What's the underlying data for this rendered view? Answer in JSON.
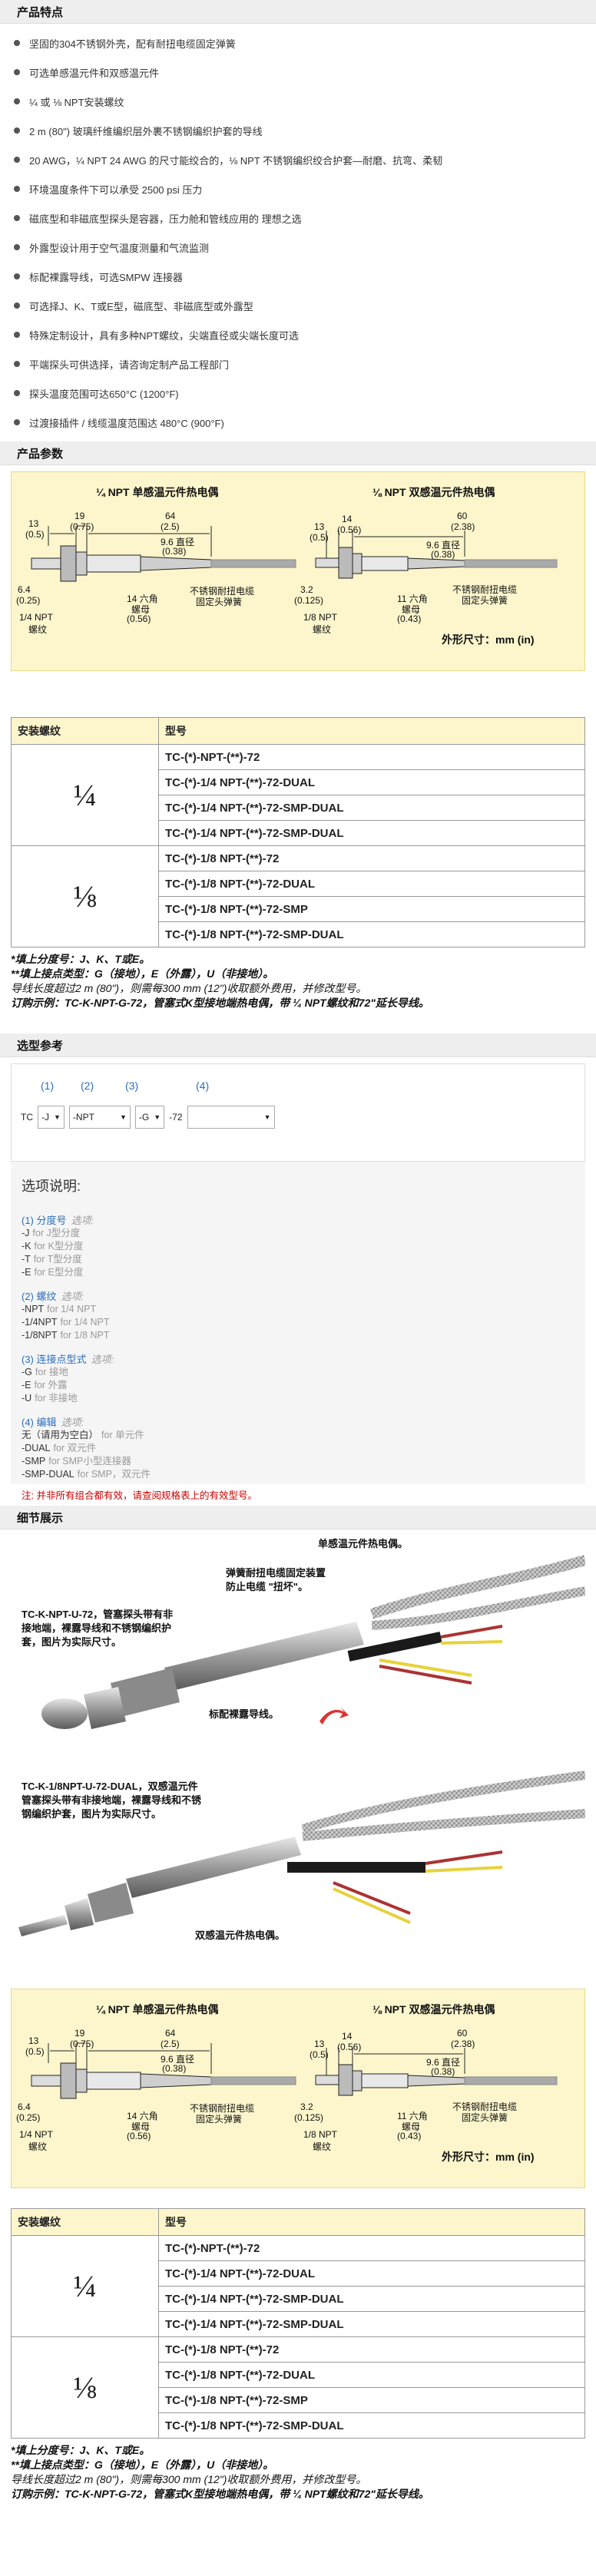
{
  "features": {
    "heading": "产品特点",
    "items": [
      "坚固的304不锈钢外壳，配有耐扭电缆固定弹簧",
      "可选单感温元件和双感温元件",
      "¼ 或 ⅛ NPT安装螺纹",
      "2 m (80\") 玻璃纤维编织层外裹不锈钢编织护套的导线",
      "20 AWG，¼ NPT 24 AWG 的尺寸能绞合的，⅛ NPT 不锈钢编织绞合护套—耐磨、抗弯、柔韧",
      "环境温度条件下可以承受 2500 psi 压力",
      "磁底型和非磁底型探头是容器，压力舱和管线应用的 理想之选",
      "外露型设计用于空气温度测量和气流监测",
      "标配裸露导线，可选SMPW 连接器",
      "可选择J、K、T或E型，磁底型、非磁底型或外露型",
      "特殊定制设计，具有多种NPT螺纹，尖端直径或尖端长度可选",
      "平端探头可供选择，请咨询定制产品工程部门",
      "探头温度范围可达650°C (1200°F)",
      "过渡接插件 / 线缆温度范围达 480°C (900°F)"
    ]
  },
  "params": {
    "heading": "产品参数"
  },
  "diagram": {
    "left_title": "¼ NPT 单感温元件热电偶",
    "right_title": "⅛ NPT 双感温元件热电偶",
    "left_dims": {
      "d13": "13",
      "d13b": "(0.5)",
      "d19": "19",
      "d19b": "(0.75)",
      "d64": "64",
      "d64b": "(2.5)",
      "dia": "9.6 直径",
      "diab": "(0.38)",
      "d64s": "6.4",
      "d64sb": "(0.25)",
      "hex": "14 六角",
      "hexb": "螺母",
      "hexc": "(0.56)",
      "npt": "1/4 NPT",
      "nptb": "螺纹",
      "spring": "不锈钢耐扭电缆",
      "springb": "固定头弹簧"
    },
    "right_dims": {
      "d13": "13",
      "d13b": "(0.5)",
      "d14": "14",
      "d14b": "(0.56)",
      "d60": "60",
      "d60b": "(2.38)",
      "dia": "9.6 直径",
      "diab": "(0.38)",
      "d32": "3.2",
      "d32b": "(0.125)",
      "hex": "11 六角",
      "hexb": "螺母",
      "hexc": "(0.43)",
      "npt": "1/8 NPT",
      "nptb": "螺纹",
      "spring": "不锈钢耐扭电缆",
      "springb": "固定头弹簧"
    },
    "unit_note": "外形尺寸：mm (in)"
  },
  "spec_table": {
    "col1": "安装螺纹",
    "col2": "型号",
    "groups": [
      {
        "thread": "¼",
        "models": [
          "TC-(*)-NPT-(**)-72",
          "TC-(*)-1/4 NPT-(**)-72-DUAL",
          "TC-(*)-1/4 NPT-(**)-72-SMP-DUAL",
          "TC-(*)-1/4 NPT-(**)-72-SMP-DUAL"
        ]
      },
      {
        "thread": "⅛",
        "models": [
          "TC-(*)-1/8 NPT-(**)-72",
          "TC-(*)-1/8 NPT-(**)-72-DUAL",
          "TC-(*)-1/8 NPT-(**)-72-SMP",
          "TC-(*)-1/8 NPT-(**)-72-SMP-DUAL"
        ]
      }
    ]
  },
  "notes": {
    "n1": "*填上分度号：J、K、T或E。",
    "n2": "**填上接点类型：G（接地），E（外露），U（非接地）。",
    "n3": "导线长度超过2 m (80\")，则需每300 mm (12\")收取额外费用，并修改型号。",
    "n4": "订购示例：TC-K-NPT-G-72，管塞式K型接地端热电偶，带 ¼ NPT螺纹和72\"延长导线。"
  },
  "selector": {
    "heading": "选型参考",
    "nums": [
      "(1)",
      "(2)",
      "(3)",
      "(4)"
    ],
    "prefix": "TC",
    "s1": "-J",
    "s2": "-NPT",
    "s3": "-G",
    "suffix": "-72",
    "s4": ""
  },
  "options": {
    "title": "选项说明:",
    "groups": [
      {
        "head": "(1) 分度号",
        "hint": "选项:",
        "lines": [
          [
            "-J",
            "for J型分度"
          ],
          [
            "-K",
            "for K型分度"
          ],
          [
            "-T",
            "for T型分度"
          ],
          [
            "-E",
            "for E型分度"
          ]
        ]
      },
      {
        "head": "(2) 螺纹",
        "hint": "选项:",
        "lines": [
          [
            "-NPT",
            "for 1/4 NPT"
          ],
          [
            "-1/4NPT",
            "for 1/4 NPT"
          ],
          [
            "-1/8NPT",
            "for 1/8 NPT"
          ]
        ]
      },
      {
        "head": "(3) 连接点型式",
        "hint": "选项:",
        "lines": [
          [
            "-G",
            "for 接地"
          ],
          [
            "-E",
            "for 外露"
          ],
          [
            "-U",
            "for 非接地"
          ]
        ]
      },
      {
        "head": "(4) 编辑",
        "hint": "选项:",
        "lines": [
          [
            "无（请用为空白）",
            "for 单元件"
          ],
          [
            "-DUAL",
            "for 双元件"
          ],
          [
            "-SMP",
            "for SMP小型连接器"
          ],
          [
            "-SMP-DUAL",
            "for SMP，双元件"
          ]
        ]
      }
    ],
    "warn": "注: 并非所有组合都有效，请查阅规格表上的有效型号。"
  },
  "details": {
    "heading": "细节展示",
    "cap1": "单感温元件热电偶。",
    "cap2": "弹簧耐扭电缆固定装置防止电缆 \"扭坏\"。",
    "cap3": "TC-K-NPT-U-72，管塞探头带有非接地端，裸露导线和不锈钢编织护套，图片为实际尺寸。",
    "cap4": "标配裸露导线。",
    "cap5": "TC-K-1/8NPT-U-72-DUAL，双感温元件管塞探头带有非接地端，裸露导线和不锈钢编织护套，图片为实际尺寸。",
    "cap6": "双感温元件热电偶。"
  },
  "colors": {
    "accent": "#fdf6cc",
    "blue": "#2a6fbf",
    "red": "#cc0000"
  }
}
